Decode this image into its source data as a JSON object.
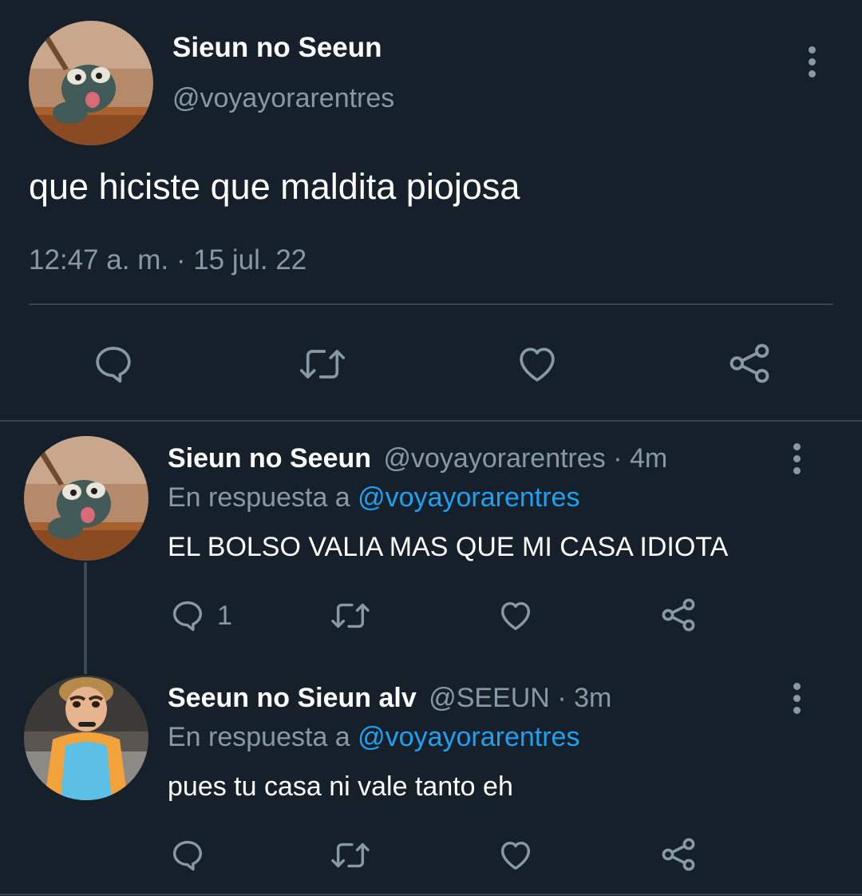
{
  "colors": {
    "background": "#15202b",
    "text": "#ffffff",
    "muted": "#8899a6",
    "link": "#1da1f2",
    "divider": "#38444d"
  },
  "main_tweet": {
    "author_name": "Sieun no Seeun",
    "author_handle": "@voyayorarentres",
    "text": "que hiciste que maldita piojosa",
    "timestamp": "12:47 a. m. · 15 jul. 22",
    "actions": [
      "reply-icon",
      "retweet-icon",
      "like-icon",
      "share-icon"
    ]
  },
  "replies": [
    {
      "author_name": "Sieun no Seeun",
      "author_handle": "@voyayorarentres",
      "time": "· 4m",
      "reply_prefix": "En respuesta a",
      "reply_to": "@voyayorarentres",
      "text": "EL BOLSO VALIA MAS QUE MI CASA IDIOTA",
      "reply_count": "1"
    },
    {
      "author_name": "Seeun no Sieun alv",
      "author_handle": "@SEEUN",
      "time": "· 3m",
      "reply_prefix": "En respuesta a",
      "reply_to": "@voyayorarentres",
      "text": "pues tu casa ni vale tanto eh",
      "reply_count": ""
    }
  ]
}
